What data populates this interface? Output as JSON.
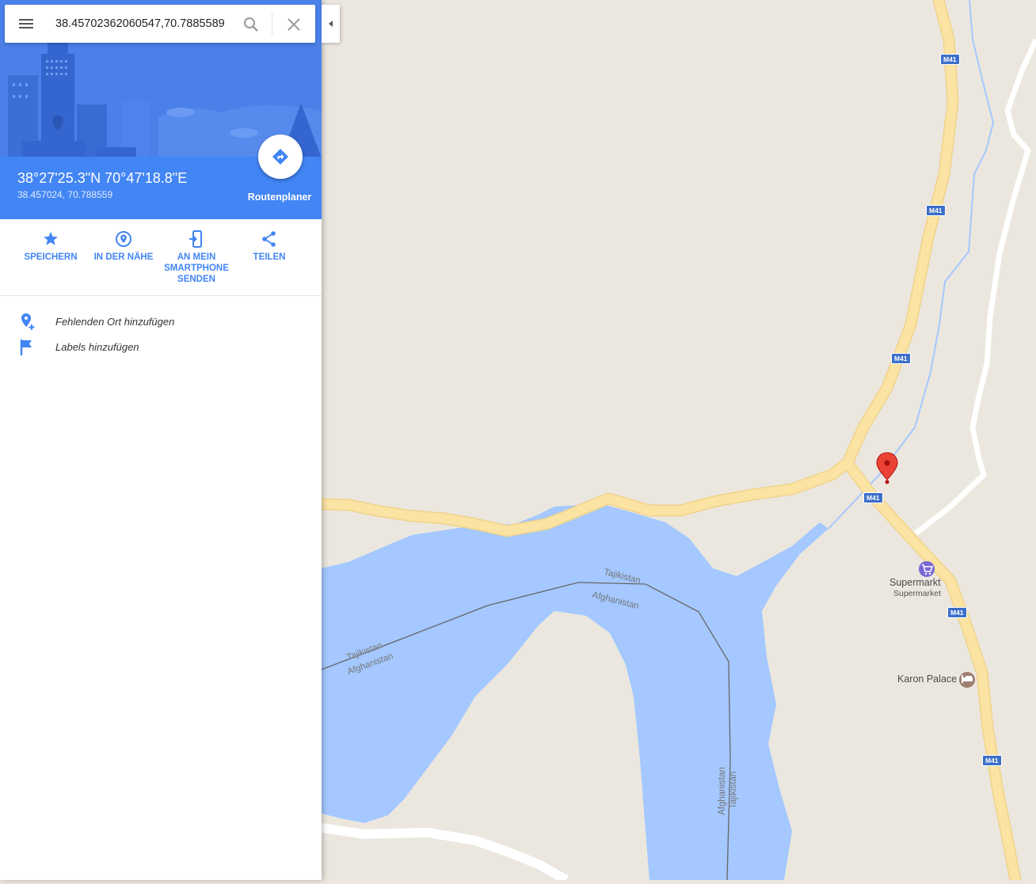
{
  "search": {
    "value": "38.45702362060547,70.7885589"
  },
  "side_panel": {
    "coordinates_dms": "38°27'25.3\"N 70°47'18.8\"E",
    "coordinates_decimal": "38.457024, 70.788559",
    "route_label": "Routenplaner",
    "actions": [
      {
        "label": "SPEICHERN",
        "icon": "star-icon"
      },
      {
        "label": "IN DER NÄHE",
        "icon": "nearby-icon"
      },
      {
        "label": "AN MEIN SMARTPHONE SENDEN",
        "icon": "send-to-phone-icon"
      },
      {
        "label": "TEILEN",
        "icon": "share-icon"
      }
    ],
    "list": [
      {
        "label": "Fehlenden Ort hinzufügen",
        "icon": "add-place-icon"
      },
      {
        "label": "Labels hinzufügen",
        "icon": "flag-icon"
      }
    ]
  },
  "map": {
    "road_shields": [
      "M41",
      "M41",
      "M41",
      "M41",
      "M41",
      "M41"
    ],
    "pois": [
      {
        "name": "Supermarkt",
        "category": "Supermarket",
        "icon": "shopping-cart-icon"
      },
      {
        "name": "Karon Palace",
        "icon": "hotel-icon"
      }
    ],
    "border_labels": [
      "Tajikistan",
      "Afghanistan",
      "Tajikistan",
      "Afghanistan",
      "Afghanistan",
      "Tajikistan"
    ]
  },
  "colors": {
    "accent": "#4285f4",
    "land": "#ebe7df",
    "water": "#a4c8ff",
    "road": "#fbe3a3",
    "marker": "#ea4335"
  }
}
